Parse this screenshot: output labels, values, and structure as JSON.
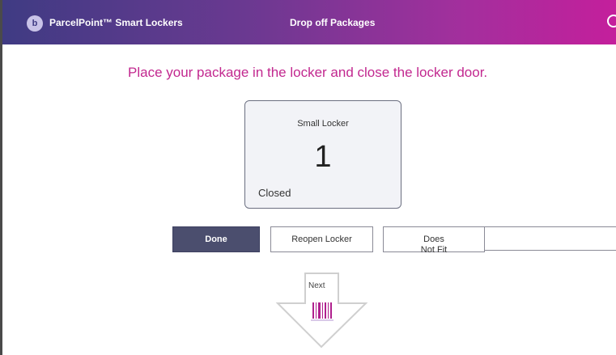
{
  "header": {
    "brand_icon_glyph": "b",
    "brand_name": "ParcelPoint™ Smart Lockers",
    "page_title": "Drop off Packages",
    "user_icon": "user-circle-icon"
  },
  "main": {
    "instruction": "Place your package in the locker and close the locker door.",
    "locker": {
      "size_label": "Small Locker",
      "number": "1",
      "status": "Closed"
    },
    "buttons": {
      "done": "Done",
      "reopen": "Reopen Locker",
      "does_not_fit": "Does Not Fit"
    },
    "next": {
      "label": "Next",
      "icon": "barcode-icon"
    }
  },
  "colors": {
    "header_start": "#3f3b83",
    "header_end": "#c41f9c",
    "accent_text": "#c2288f",
    "done_button": "#4b4e6e",
    "barcode": "#b0208e"
  }
}
